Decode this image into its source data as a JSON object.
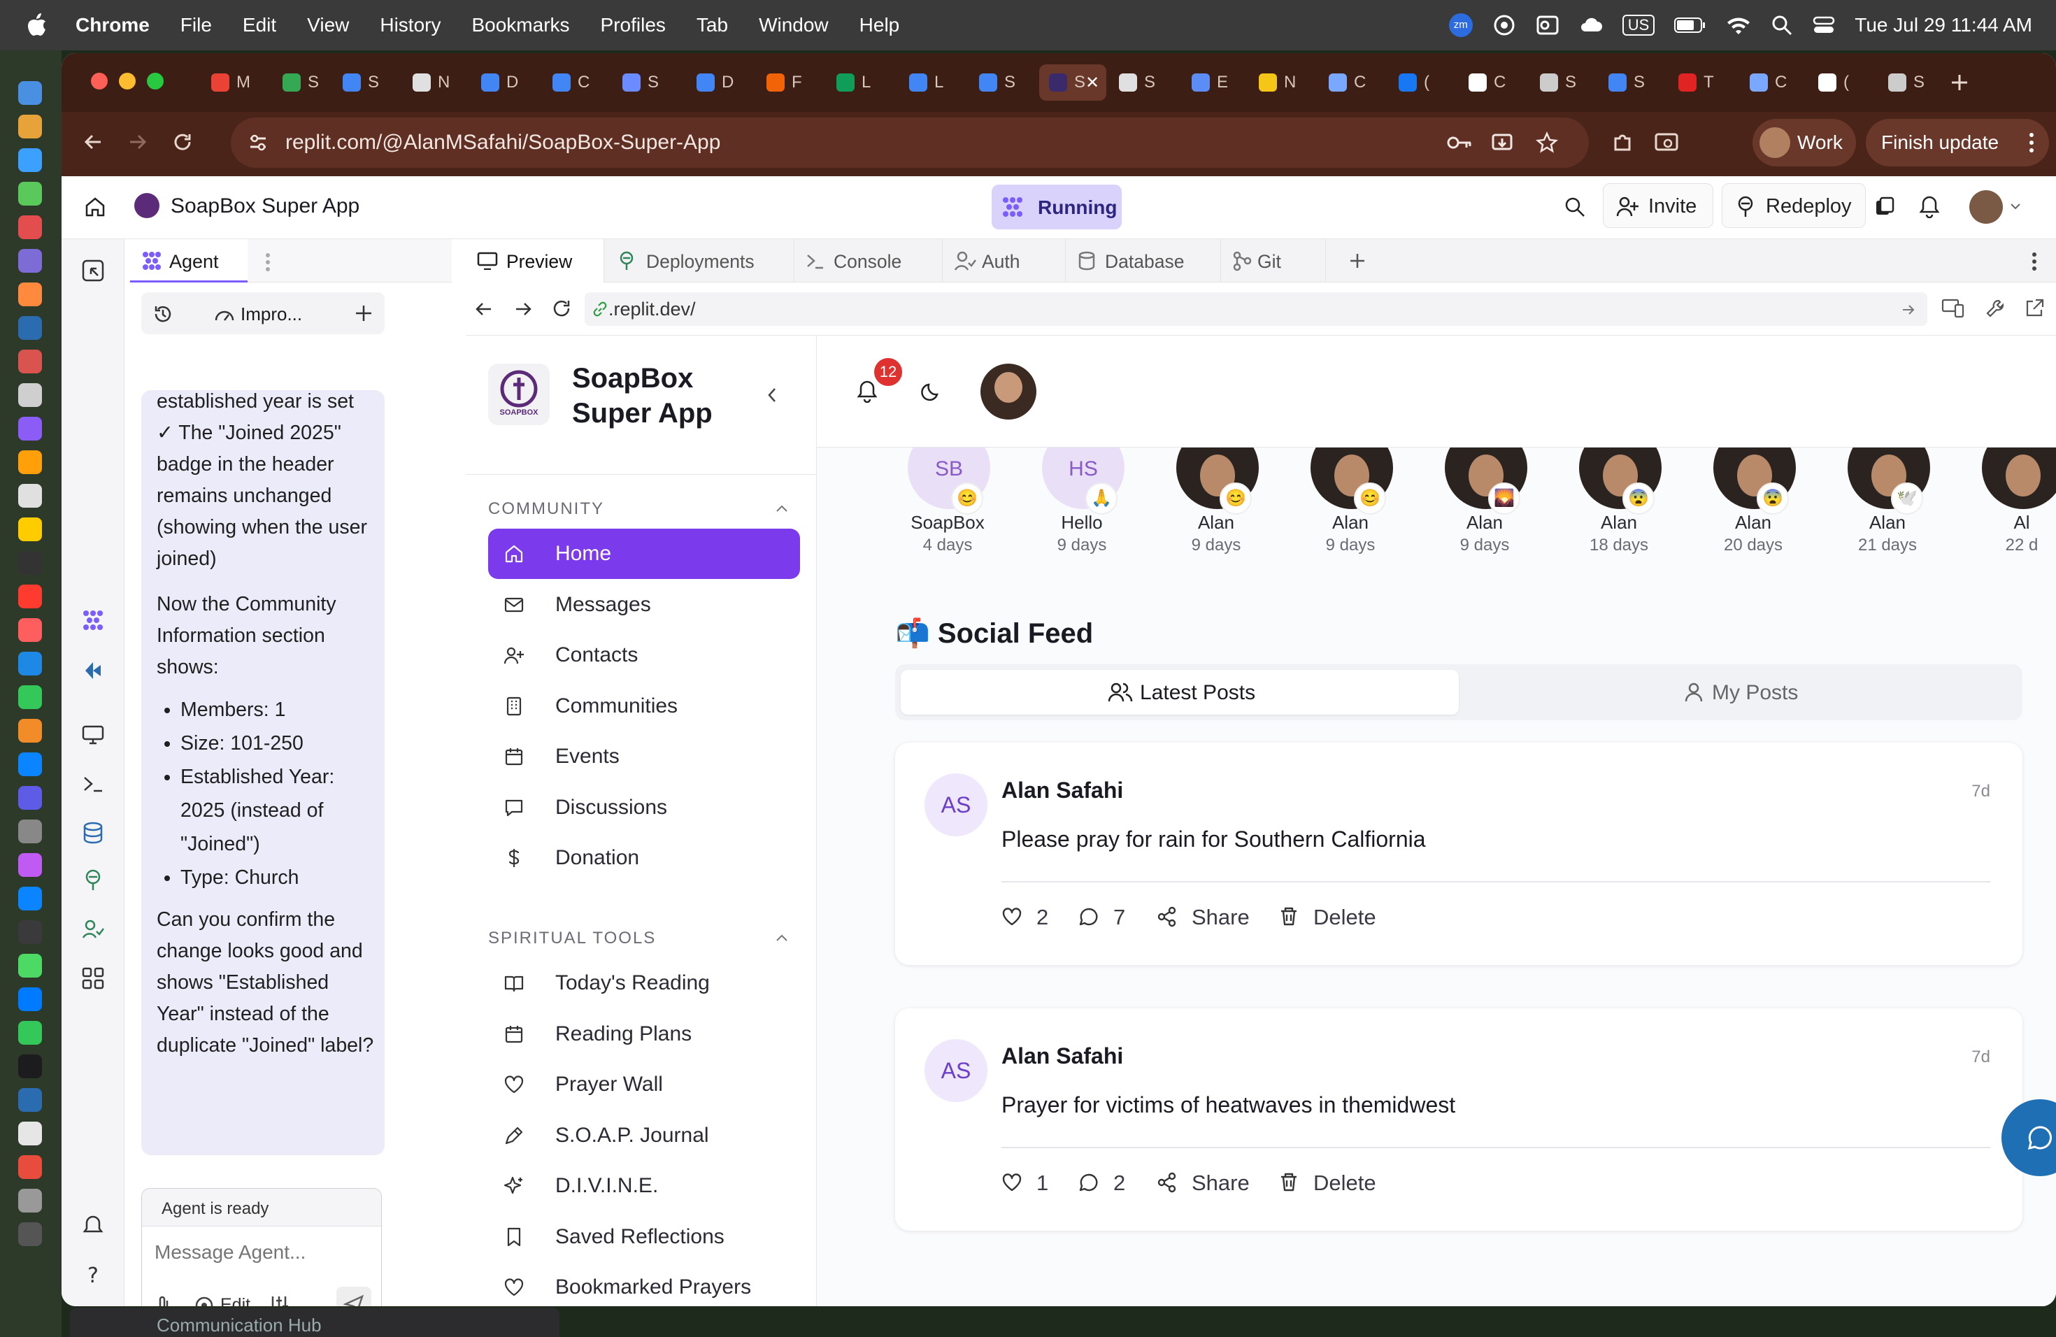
{
  "menubar": {
    "app": "Chrome",
    "items": [
      "File",
      "Edit",
      "View",
      "History",
      "Bookmarks",
      "Profiles",
      "Tab",
      "Window",
      "Help"
    ],
    "status": {
      "zoom": "zm",
      "input": "US",
      "datetime": "Tue Jul 29  11:44 AM"
    }
  },
  "browser": {
    "tabs": [
      {
        "icon": "gmail-icon",
        "label": "M",
        "color": "#ea4335"
      },
      {
        "icon": "drive-icon",
        "label": "S",
        "color": "#34a853"
      },
      {
        "icon": "docs-icon",
        "label": "S",
        "color": "#4285f4"
      },
      {
        "icon": "openai-icon",
        "label": "N",
        "color": "#e0e0e0"
      },
      {
        "icon": "docs-icon",
        "label": "D",
        "color": "#4285f4"
      },
      {
        "icon": "docs-icon",
        "label": "C",
        "color": "#4285f4"
      },
      {
        "icon": "site-icon",
        "label": "S",
        "color": "#6b8cff"
      },
      {
        "icon": "docs-icon",
        "label": "D",
        "color": "#4285f4"
      },
      {
        "icon": "replit-icon",
        "label": "F",
        "color": "#f26207"
      },
      {
        "icon": "sheets-icon",
        "label": "L",
        "color": "#0f9d58"
      },
      {
        "icon": "docs-icon",
        "label": "L",
        "color": "#4285f4"
      },
      {
        "icon": "docs-icon",
        "label": "S",
        "color": "#4285f4"
      },
      {
        "icon": "active-tab-icon",
        "label": "S",
        "color": "#3b2a6b"
      },
      {
        "icon": "openai-icon",
        "label": "S",
        "color": "#e0e0e0"
      },
      {
        "icon": "site-icon",
        "label": "E",
        "color": "#5c8df6"
      },
      {
        "icon": "site-icon",
        "label": "N",
        "color": "#f5c518"
      },
      {
        "icon": "gemini-icon",
        "label": "C",
        "color": "#7aa7ff"
      },
      {
        "icon": "facebook-icon",
        "label": "(",
        "color": "#1877f2"
      },
      {
        "icon": "github-icon",
        "label": "C",
        "color": "#ffffff"
      },
      {
        "icon": "globe-icon",
        "label": "S",
        "color": "#cccccc"
      },
      {
        "icon": "google-icon",
        "label": "S",
        "color": "#4285f4"
      },
      {
        "icon": "site-icon",
        "label": "T",
        "color": "#e02424"
      },
      {
        "icon": "gemini-icon",
        "label": "C",
        "color": "#7aa7ff"
      },
      {
        "icon": "x-icon",
        "label": "(",
        "color": "#ffffff"
      },
      {
        "icon": "globe-icon",
        "label": "S",
        "color": "#cccccc"
      }
    ],
    "url": "replit.com/@AlanMSafahi/SoapBox-Super-App",
    "profile": "Work",
    "update": "Finish update"
  },
  "replit": {
    "project": "SoapBox Super App",
    "status": "Running",
    "invite": "Invite",
    "redeploy": "Redeploy",
    "agent_tab": "Agent",
    "agent_toolbar_label": "Impro...",
    "agent_message": {
      "lead": "established year is set",
      "check": "✓ The \"Joined 2025\" badge in the header remains unchanged (showing when the user joined)",
      "intro": "Now the Community Information section shows:",
      "bullets": [
        "Members: 1",
        "Size: 101-250",
        "Established Year: 2025 (instead of \"Joined\")",
        "Type: Church"
      ],
      "question": "Can you confirm the change looks good and shows \"Established Year\" instead of the duplicate \"Joined\" label?"
    },
    "agent_status": "Agent is ready",
    "agent_placeholder": "Message Agent...",
    "agent_edit": "Edit",
    "pane_tabs": [
      "Preview",
      "Deployments",
      "Console",
      "Auth",
      "Database",
      "Git"
    ],
    "preview_url": ".replit.dev/"
  },
  "app": {
    "name_line1": "SoapBox",
    "name_line2": "Super App",
    "logo_text": "SOAPBOX",
    "notifications": "12",
    "sections": [
      {
        "title": "COMMUNITY",
        "items": [
          {
            "label": "Home",
            "icon": "home-icon",
            "active": true
          },
          {
            "label": "Messages",
            "icon": "mail-icon"
          },
          {
            "label": "Contacts",
            "icon": "user-plus-icon"
          },
          {
            "label": "Communities",
            "icon": "building-icon"
          },
          {
            "label": "Events",
            "icon": "calendar-icon"
          },
          {
            "label": "Discussions",
            "icon": "chat-icon"
          },
          {
            "label": "Donation",
            "icon": "dollar-icon"
          }
        ]
      },
      {
        "title": "SPIRITUAL TOOLS",
        "items": [
          {
            "label": "Today's Reading",
            "icon": "book-icon"
          },
          {
            "label": "Reading Plans",
            "icon": "calendar-icon"
          },
          {
            "label": "Prayer Wall",
            "icon": "heart-icon"
          },
          {
            "label": "S.O.A.P. Journal",
            "icon": "pen-icon"
          },
          {
            "label": "D.I.V.I.N.E.",
            "icon": "sparkle-icon"
          },
          {
            "label": "Saved Reflections",
            "icon": "bookmark-icon"
          },
          {
            "label": "Bookmarked Prayers",
            "icon": "heart-icon"
          }
        ]
      }
    ],
    "stories": [
      {
        "name": "SoapBox",
        "time": "4 days",
        "emoji": "😊",
        "initials": "SB"
      },
      {
        "name": "Hello",
        "time": "9 days",
        "emoji": "🙏",
        "initials": "HS"
      },
      {
        "name": "Alan",
        "time": "9 days",
        "emoji": "😊"
      },
      {
        "name": "Alan",
        "time": "9 days",
        "emoji": "😊"
      },
      {
        "name": "Alan",
        "time": "9 days",
        "emoji": "🌄"
      },
      {
        "name": "Alan",
        "time": "18 days",
        "emoji": "😨"
      },
      {
        "name": "Alan",
        "time": "20 days",
        "emoji": "😨"
      },
      {
        "name": "Alan",
        "time": "21 days",
        "emoji": "🕊️"
      },
      {
        "name": "Al",
        "time": "22 d",
        "emoji": ""
      }
    ],
    "feed_title": "📬 Social Feed",
    "feed_tabs": [
      "Latest Posts",
      "My Posts"
    ],
    "posts": [
      {
        "initials": "AS",
        "author": "Alan Safahi",
        "time": "7d",
        "text": "Please pray for rain for Southern Calfiornia",
        "likes": "2",
        "comments": "7",
        "share": "Share",
        "delete": "Delete"
      },
      {
        "initials": "AS",
        "author": "Alan Safahi",
        "time": "7d",
        "text": "Prayer for victims of heatwaves in themidwest",
        "likes": "1",
        "comments": "2",
        "share": "Share",
        "delete": "Delete"
      }
    ]
  },
  "background_window": "Communication Hub",
  "colors": {
    "accent": "#7c3aed",
    "tabbar": "#3c1e14",
    "addrbar": "#4a2418",
    "running_bg": "#d9d3fb",
    "agent_bubble": "#ecebfa"
  }
}
